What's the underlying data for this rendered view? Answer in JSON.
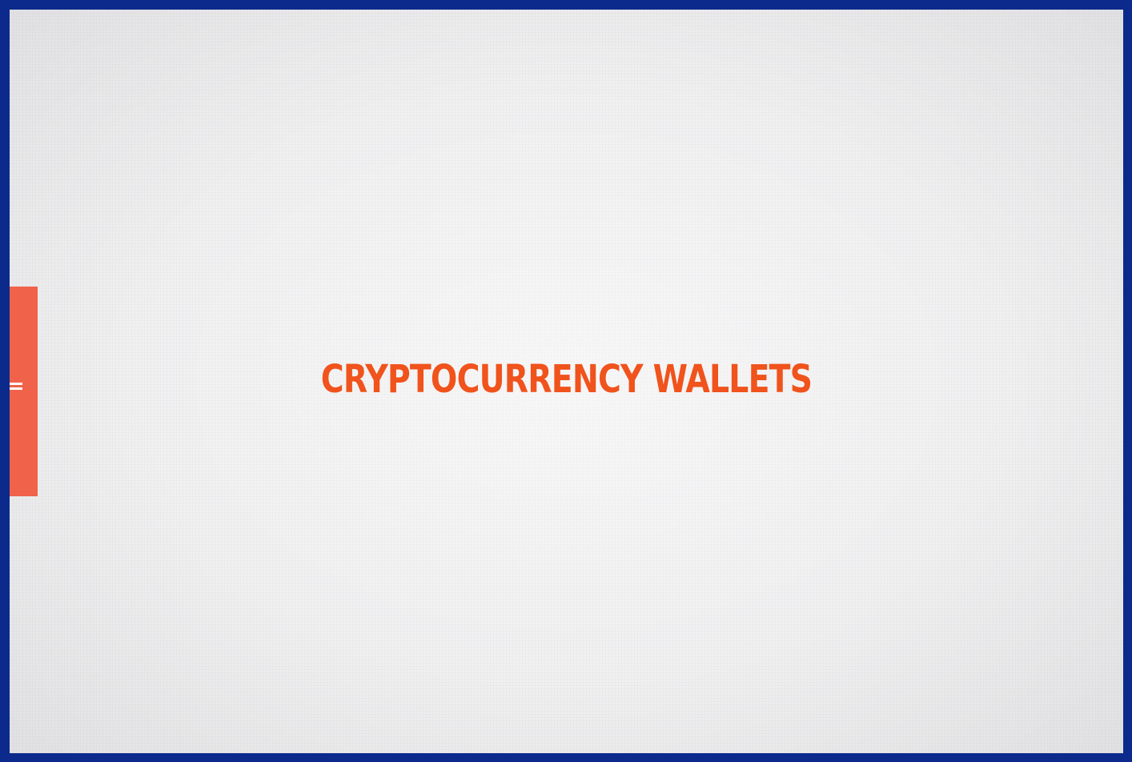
{
  "slide": {
    "title": "CRYPTOCURRENCY WALLETS"
  },
  "colors": {
    "border": "#0b2a8c",
    "background": "#eeeeef",
    "title": "#f0531c",
    "side_tab": "#f0624a"
  },
  "side_tab": {
    "icon": "menu-icon"
  }
}
